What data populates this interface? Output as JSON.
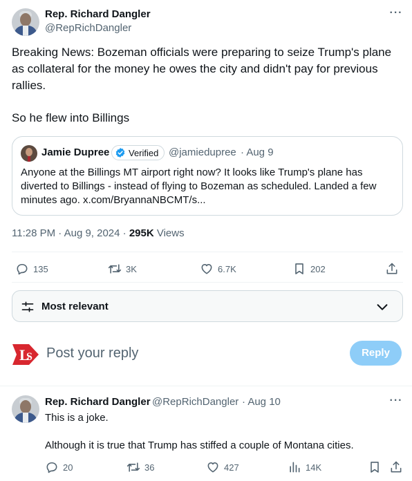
{
  "post": {
    "author_name": "Rep. Richard Dangler",
    "author_handle": "@RepRichDangler",
    "text_p1": "Breaking News: Bozeman officials were preparing to seize Trump's plane as collateral for the money he owes the city and didn't pay for previous rallies.",
    "text_p2": "So he flew into Billings",
    "quote": {
      "author_name": "Jamie Dupree",
      "verified_label": "Verified",
      "author_handle": "@jamiedupree",
      "date": "· Aug 9",
      "text": "Anyone at the Billings MT airport right now?  It looks like Trump's plane has diverted to Billings - instead of flying to Bozeman as scheduled.  Landed a few minutes ago. x.com/BryannaNBCMT/s..."
    },
    "timestamp": "11:28 PM · Aug 9, 2024 · ",
    "views_count": "295K",
    "views_label": " Views",
    "actions": {
      "replies": "135",
      "reposts": "3K",
      "likes": "6.7K",
      "bookmarks": "202"
    }
  },
  "sort": {
    "label": "Most relevant"
  },
  "composer": {
    "placeholder": "Post your reply",
    "reply_button": "Reply"
  },
  "reply": {
    "author_name": "Rep. Richard Dangler",
    "author_handle": "@RepRichDangler",
    "date": "· Aug 10",
    "line1": "This is a joke.",
    "line2": "Although it is true that Trump has stiffed a couple of Montana cities.",
    "actions": {
      "replies": "20",
      "reposts": "36",
      "likes": "427",
      "views": "14K"
    }
  },
  "colors": {
    "text_primary": "#0f1419",
    "text_muted": "#536471",
    "accent_blue": "#1d9bf0",
    "reply_button_disabled": "#8ecdf8",
    "border": "#cfd9de",
    "logo_red": "#d8272f"
  }
}
